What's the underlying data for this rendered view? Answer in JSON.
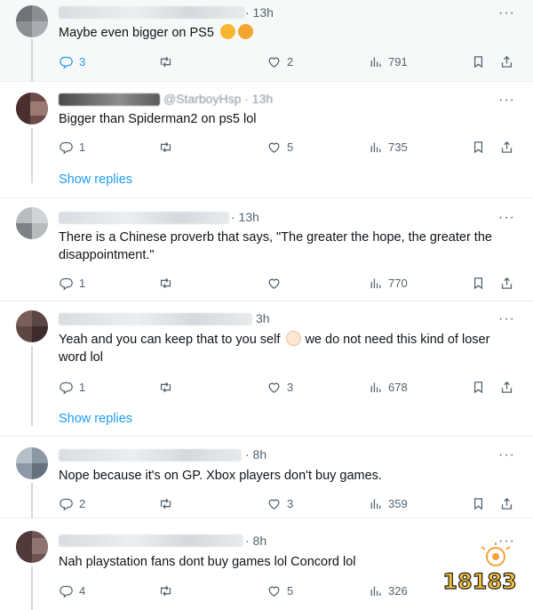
{
  "tweets": [
    {
      "time": "· 13h",
      "text": "Maybe even bigger on PS5",
      "emojis": [
        "thinking-face-emoji",
        "hugging-face-emoji"
      ],
      "reply": "3",
      "retweet": "",
      "like": "2",
      "views": "791"
    },
    {
      "handle": "@StarboyHsp · 13h",
      "text": "Bigger than Spiderman2 on ps5 lol",
      "reply": "1",
      "retweet": "",
      "like": "5",
      "views": "735",
      "show_replies": "Show replies"
    },
    {
      "time": "· 13h",
      "text": "There is a Chinese proverb that says, \"The greater the hope, the greater the disappointment.\"",
      "reply": "1",
      "retweet": "",
      "like": "",
      "views": "770"
    },
    {
      "time": "3h",
      "text_a": "Yeah and you can keep that to you self",
      "text_b": "we do not need this kind of loser word lol",
      "emoji": "clown-face-emoji",
      "reply": "1",
      "retweet": "",
      "like": "3",
      "views": "678",
      "show_replies": "Show replies"
    },
    {
      "time": "· 8h",
      "text": "Nope because it's on GP. Xbox players don't buy games.",
      "reply": "2",
      "retweet": "",
      "like": "3",
      "views": "359"
    },
    {
      "time": "· 8h",
      "text": "Nah playstation fans dont buy games lol Concord lol",
      "reply": "4",
      "retweet": "",
      "like": "5",
      "views": "326"
    }
  ],
  "watermark": "18183",
  "colors": {
    "link": "#1d9bf0",
    "muted": "#536471",
    "hover_bg": "#f7f9f9"
  }
}
